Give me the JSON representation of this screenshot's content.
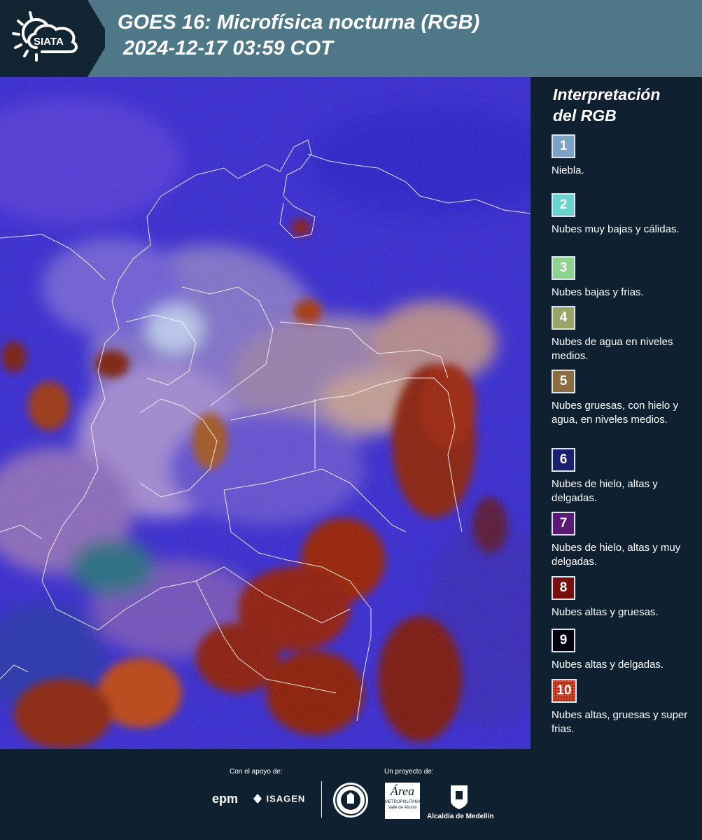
{
  "header": {
    "logo_text": "SIATA",
    "title_line1": "GOES 16: Microfísica nocturna (RGB)",
    "title_line2": "2024-12-17 03:59 COT"
  },
  "legend": {
    "title_line1": "Interpretación",
    "title_line2": "del RGB",
    "items": [
      {
        "num": "1",
        "label": "Niebla.",
        "color": "#7ba3c8"
      },
      {
        "num": "2",
        "label": "Nubes muy bajas y cálidas.",
        "color": "#69d3cf"
      },
      {
        "num": "3",
        "label": "Nubes bajas y frias.",
        "color": "#8fd48e"
      },
      {
        "num": "4",
        "label": "Nubes de agua en niveles medios.",
        "color": "#9aa568"
      },
      {
        "num": "5",
        "label": "Nubes gruesas, con hielo y agua, en niveles medios.",
        "color": "#8b6d3f"
      },
      {
        "num": "6",
        "label": "Nubes de hielo, altas y delgadas.",
        "color": "#1a1f6e"
      },
      {
        "num": "7",
        "label": "Nubes de hielo, altas y muy delgadas.",
        "color": "#5a1a74"
      },
      {
        "num": "8",
        "label": "Nubes altas y gruesas.",
        "color": "#7a0d0d"
      },
      {
        "num": "9",
        "label": "Nubes altas y delgadas.",
        "color": "#05050f"
      },
      {
        "num": "10",
        "label": "Nubes altas, gruesas y super frias.",
        "color": "#b3261a"
      }
    ]
  },
  "footer": {
    "support_label": "Con el apoyo de:",
    "project_label": "Un proyecto de:",
    "epm": "epm",
    "isagen": "ISAGEN",
    "metro_name": "Área",
    "metro_sub": "METROPOLITANA",
    "metro_sub2": "Valle de Aburrá",
    "alcaldia": "Alcaldía de Medellín"
  }
}
